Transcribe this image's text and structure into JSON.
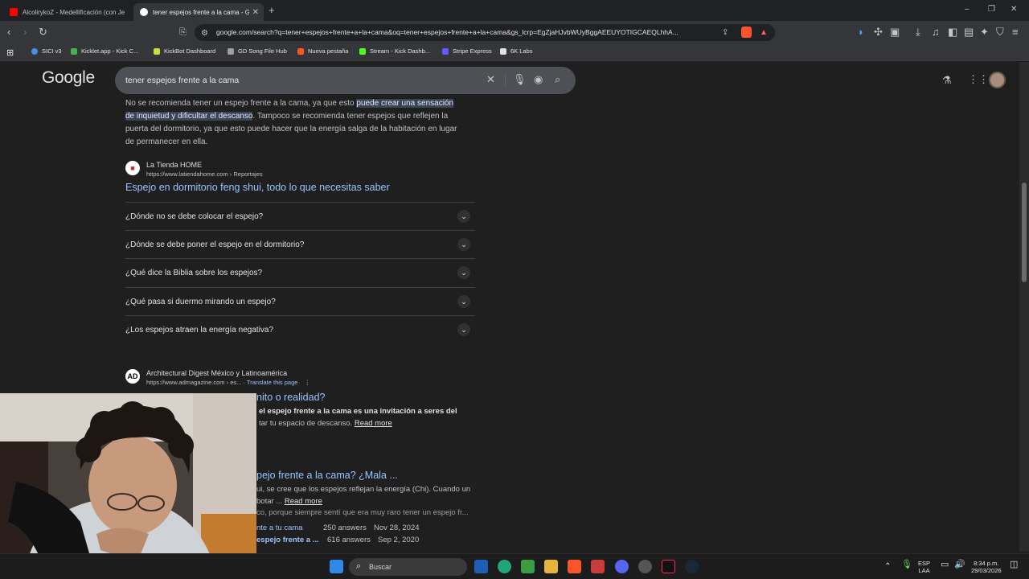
{
  "tabs": [
    {
      "label": "AlcolirykoZ - Medellificación (con Je",
      "active": false
    },
    {
      "label": "tener espejos frente a la cama - Go",
      "active": true
    }
  ],
  "new_tab": "+",
  "window": {
    "minimize": "–",
    "maximize": "❐",
    "close": "✕"
  },
  "toolbar": {
    "url": "google.com/search?q=tener+espejos+frente+a+la+cama&oq=tener+espejos+frente+a+la+cama&gs_lcrp=EgZjaHJvbWUyBggAEEUYOTIGCAEQLhhA..."
  },
  "bookmarks": [
    {
      "label": "SICI v3",
      "color": "#4a90e2"
    },
    {
      "label": "Kicklet.app - Kick C...",
      "color": "#4caf50"
    },
    {
      "label": "KickBot Dashboard",
      "color": "#cddc39"
    },
    {
      "label": "GD Song File Hub",
      "color": "#9e9e9e"
    },
    {
      "label": "Nueva pestaña",
      "color": "#ff5722"
    },
    {
      "label": "Stream - Kick Dashb...",
      "color": "#53fc18"
    },
    {
      "label": "Stripe Express",
      "color": "#635bff"
    },
    {
      "label": "6K Labs",
      "color": "#e0e0e0"
    }
  ],
  "google": {
    "logo": "Google",
    "query": "tener espejos frente a la cama"
  },
  "snippet": {
    "l1a": "No se recomienda tener un espejo frente a la cama, ya que esto ",
    "l1b": "puede crear una sensación",
    "l2a": "de inquietud y dificultar el descanso",
    "l2b": ". Tampoco se recomienda tener espejos que reflejen la",
    "l3": "puerta del dormitorio, ya que esto puede hacer que la energía salga de la habitación en lugar",
    "l4": "de permanecer en ella."
  },
  "result1": {
    "source": "La Tienda HOME",
    "url": "https://www.latiendahome.com › Reportajes",
    "title": "Espejo en dormitorio feng shui, todo lo que necesitas saber"
  },
  "paa": [
    "¿Dónde no se debe colocar el espejo?",
    "¿Dónde se debe poner el espejo en el dormitorio?",
    "¿Qué dice la Biblia sobre los espejos?",
    "¿Qué pasa si duermo mirando un espejo?",
    "¿Los espejos atraen la energía negativa?"
  ],
  "result2": {
    "source": "Architectural Digest México y Latinoamérica",
    "url": "https://www.admagazine.com › es...",
    "translate": "Translate this page",
    "title_tail": "nito o realidad?",
    "body1": "el espejo frente a la cama es una invitación a seres del",
    "body2": "tar tu espacio de descanso.",
    "read_more": "Read more"
  },
  "result3": {
    "title_tail": "pejo frente a la cama? ¿Mala ...",
    "body1": "ui, se cree que los espejos reflejan la energía (Chi). Cuando un",
    "body2": "botar ...",
    "read_more": "Read more",
    "body3": "co, porque siempre sentí que era muy raro tener un espejo fr...",
    "rows": [
      {
        "a": "nte a tu cama",
        "b": "250 answers",
        "c": "Nov 28, 2024"
      },
      {
        "a": "espejo frente a ...",
        "b": "616 answers",
        "c": "Sep 2, 2020"
      }
    ]
  },
  "taskbar": {
    "search": "Buscar",
    "lang1": "ESP",
    "lang2": "LAA",
    "time": "8:34 p.m.",
    "date": "29/03/2026"
  }
}
